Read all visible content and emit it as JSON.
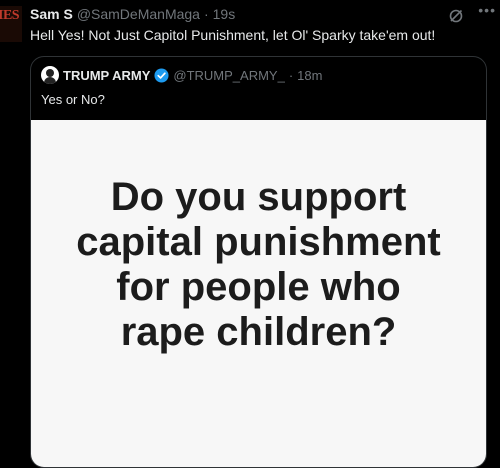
{
  "tweet": {
    "display_name": "Sam S",
    "handle": "@SamDeManMaga",
    "separator": "·",
    "time": "19s",
    "text": "Hell Yes! Not Just Capitol Punishment, let Ol' Sparky take'em out!",
    "avatar_text": "IES"
  },
  "quote": {
    "display_name": "TRUMP ARMY",
    "handle": "@TRUMP_ARMY_",
    "separator": "·",
    "time": "18m",
    "text": "Yes or No?",
    "image_lines": [
      "Do you support",
      "capital punishment",
      "for people who",
      "rape children?"
    ]
  },
  "icons": {
    "grok": "grok-icon",
    "more": "more-icon",
    "verified": "verified-badge-icon"
  },
  "colors": {
    "background": "#000000",
    "text": "#e7e9ea",
    "muted": "#71767b",
    "verified": "#1d9bf0",
    "border": "#2f3336"
  }
}
